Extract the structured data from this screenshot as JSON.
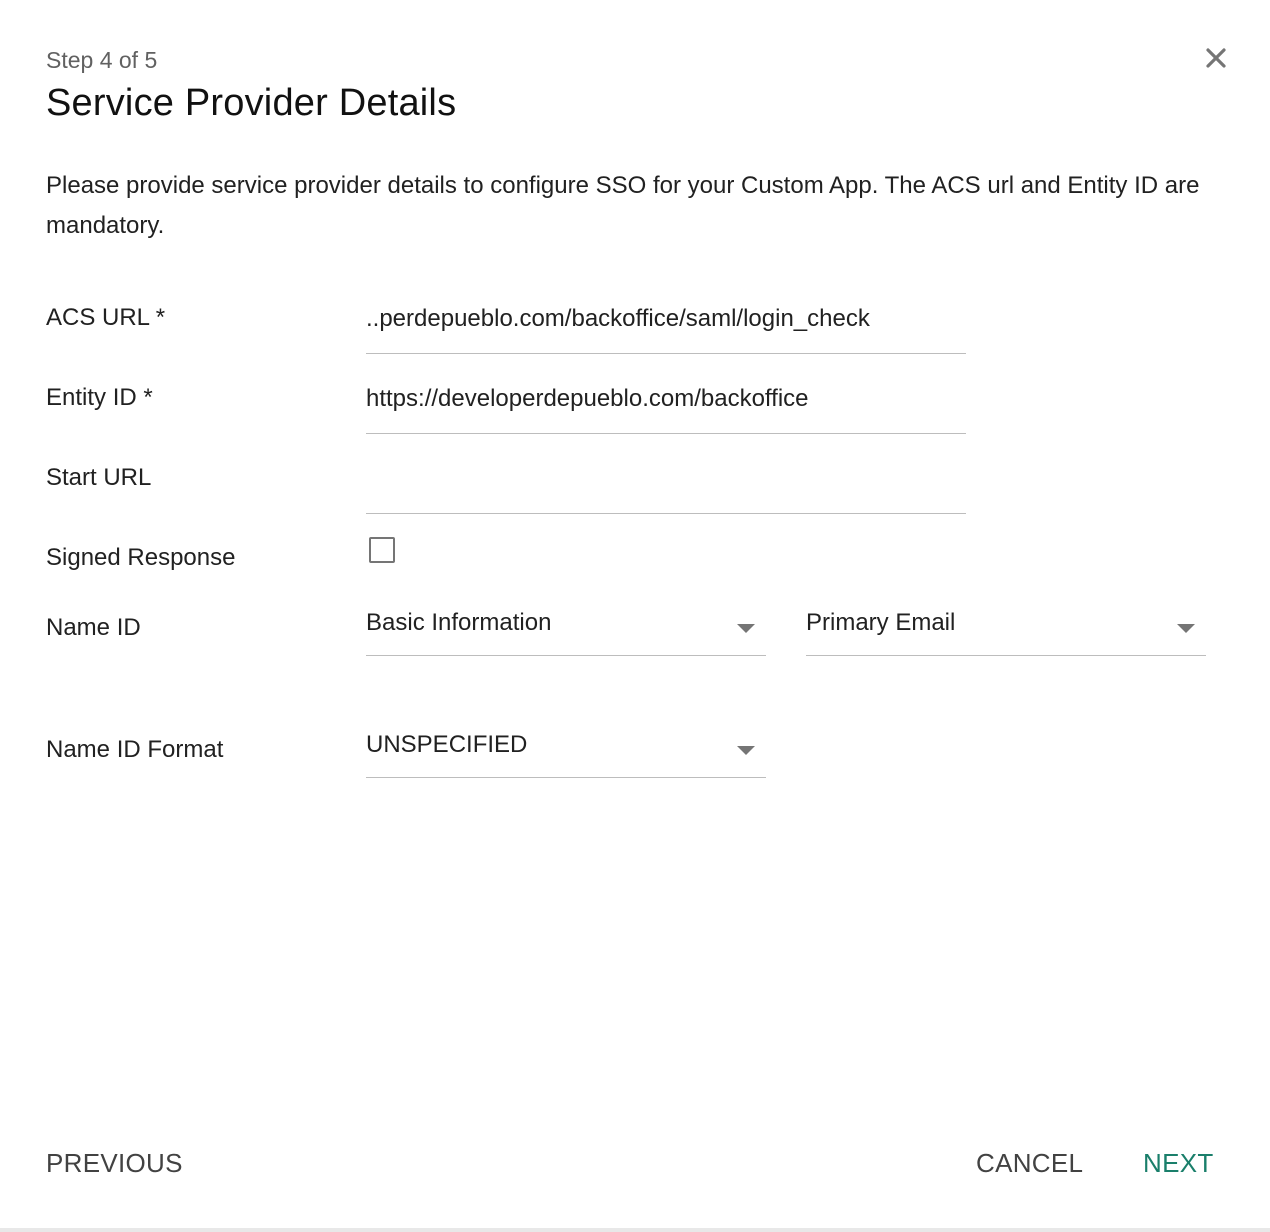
{
  "header": {
    "step_text": "Step 4 of 5",
    "title": "Service Provider Details",
    "close_icon": "close-icon"
  },
  "description": "Please provide service provider details to configure SSO for your Custom App. The ACS url and Entity ID are mandatory.",
  "form": {
    "acs_url": {
      "label": "ACS URL *",
      "value": "..perdepueblo.com/backoffice/saml/login_check"
    },
    "entity_id": {
      "label": "Entity ID *",
      "value": "https://developerdepueblo.com/backoffice"
    },
    "start_url": {
      "label": "Start URL",
      "value": ""
    },
    "signed_response": {
      "label": "Signed Response",
      "checked": false
    },
    "name_id": {
      "label": "Name ID",
      "category": "Basic Information",
      "attribute": "Primary Email"
    },
    "name_id_format": {
      "label": "Name ID Format",
      "value": "UNSPECIFIED"
    }
  },
  "footer": {
    "previous_label": "PREVIOUS",
    "cancel_label": "CANCEL",
    "next_label": "NEXT"
  },
  "colors": {
    "accent": "#1a7f6b",
    "underline": "#bdbdbd",
    "text": "#212121"
  }
}
